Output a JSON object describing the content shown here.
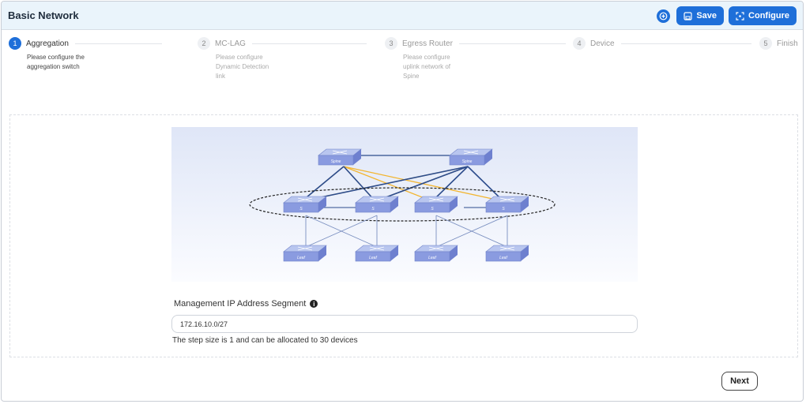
{
  "header": {
    "title": "Basic Network",
    "save_label": "Save",
    "configure_label": "Configure"
  },
  "steps": [
    {
      "num": "1",
      "label": "Aggregation",
      "desc": [
        "Please configure the",
        "aggregation switch"
      ],
      "active": true
    },
    {
      "num": "2",
      "label": "MC-LAG",
      "desc": [
        "Please configure",
        "Dynamic Detection",
        "link"
      ],
      "active": false
    },
    {
      "num": "3",
      "label": "Egress Router",
      "desc": [
        "Please configure",
        "uplink network of",
        "Spine"
      ],
      "active": false
    },
    {
      "num": "4",
      "label": "Device",
      "desc": [],
      "active": false
    },
    {
      "num": "5",
      "label": "Finish",
      "desc": [],
      "active": false
    }
  ],
  "diagram": {
    "spine_label": "Spine",
    "leaf_label": "Leaf",
    "agg_labels": [
      "S",
      "S",
      "S",
      "S"
    ]
  },
  "form": {
    "ip_label": "Management IP Address Segment",
    "ip_value": "172.16.10.0/27",
    "helper": "The step size is 1 and can be allocated to 30 devices"
  },
  "footer": {
    "next_label": "Next"
  },
  "colors": {
    "primary": "#1e6fd9",
    "link_orange": "#f2b530",
    "link_blue": "#2c4c8c"
  }
}
